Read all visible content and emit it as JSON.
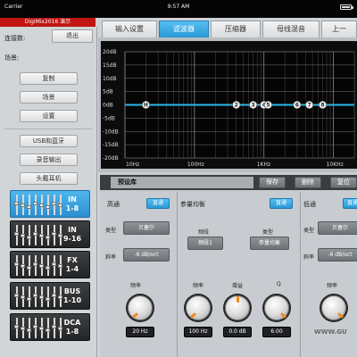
{
  "statusbar": {
    "carrier": "Carrier ",
    "time": "9:57 AM"
  },
  "device": {
    "name": "DigiMix2016 演示"
  },
  "sidebar": {
    "connect_label": "连接数:",
    "logout": "退出",
    "scene_label": "场景:",
    "buttons": [
      "复制",
      "场景",
      "设置"
    ],
    "buttons2": [
      "USB和蓝牙",
      "录音输出",
      "头戴耳机"
    ],
    "channels": [
      {
        "label": "IN\n1-8",
        "active": true
      },
      {
        "label": "IN\n9-16",
        "active": false
      },
      {
        "label": "FX\n1-4",
        "active": false
      },
      {
        "label": "BUS\n1-10",
        "active": false
      },
      {
        "label": "DCA\n1-8",
        "active": false
      }
    ]
  },
  "tabs": [
    {
      "label": "输入设置",
      "active": false
    },
    {
      "label": "滤波器",
      "active": true
    },
    {
      "label": "压缩器",
      "active": false
    },
    {
      "label": "母线混音",
      "active": false
    },
    {
      "label": "上一",
      "active": false
    }
  ],
  "graph": {
    "y_ticks": [
      "20dB",
      "15dB",
      "10dB",
      "5dB",
      "0dB",
      "-5dB",
      "-10dB",
      "-15dB",
      "-20dB"
    ],
    "y_values": [
      20,
      15,
      10,
      5,
      0,
      -5,
      -10,
      -15,
      -20
    ],
    "x_ticks": [
      {
        "label": "10Hz",
        "value": 10
      },
      {
        "label": "100Hz",
        "value": 100
      },
      {
        "label": "1KHz",
        "value": 1000
      },
      {
        "label": "10KHz",
        "value": 10000
      }
    ],
    "curve_gain_db": 0,
    "line_color": "#2bb8e8",
    "bands": [
      {
        "label": "H",
        "freq": 20
      },
      {
        "label": "2",
        "freq": 400
      },
      {
        "label": "3",
        "freq": 700
      },
      {
        "label": "4",
        "freq": 1000
      },
      {
        "label": "5",
        "freq": 1150
      },
      {
        "label": "6",
        "freq": 3000
      },
      {
        "label": "7",
        "freq": 4500
      },
      {
        "label": "8",
        "freq": 7000
      }
    ]
  },
  "preset": {
    "title": "预设库",
    "save": "保存",
    "delete": "删除",
    "reset": "复位"
  },
  "highpass": {
    "title": "高通",
    "toggle": "直通",
    "type_label": "类型",
    "type_value": "贝塞尔",
    "slope_label": "斜率",
    "slope_value": "-6 dB/oct",
    "freq_label": "频率",
    "freq_value": "20 Hz"
  },
  "parametric": {
    "title": "参量均衡",
    "toggle": "直通",
    "band_label": "频段",
    "band_value": "频段1",
    "type_label": "类型",
    "type_value": "参量均衡",
    "freq_label": "频率",
    "freq_value": "100 Hz",
    "gain_label": "增益",
    "gain_value": "0.0 dB",
    "q_label": "Q",
    "q_value": "6.00"
  },
  "lowpass": {
    "title": "低通",
    "toggle": "直通",
    "type_label": "类型",
    "type_value": "贝塞尔",
    "slope_label": "斜率",
    "slope_value": "-6 dB/oct",
    "freq_label": "频率"
  },
  "watermark": "WWW.GU"
}
